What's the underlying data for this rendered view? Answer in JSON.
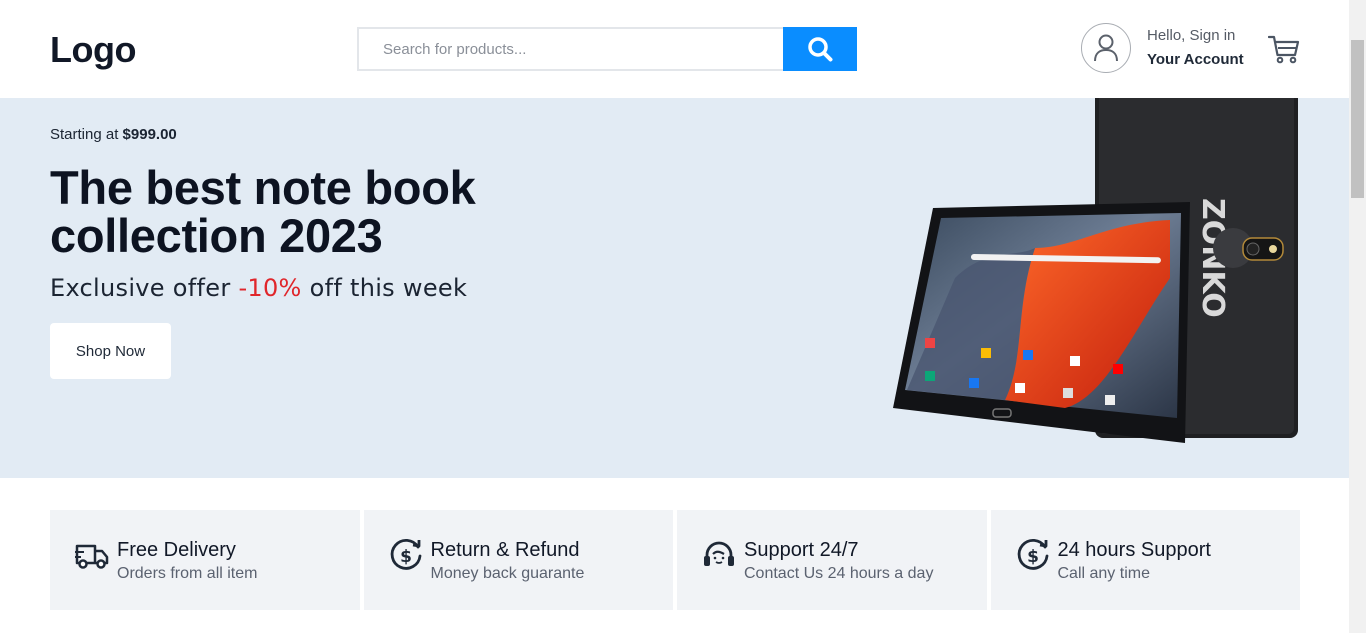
{
  "header": {
    "logo": "Logo",
    "search_placeholder": "Search for products...",
    "account_greeting": "Hello, Sign in",
    "account_label": "Your Account",
    "accent_color": "#0a8dff"
  },
  "hero": {
    "starting_prefix": "Starting at ",
    "starting_price": "$999.00",
    "title": "The best note book collection 2023",
    "offer_prefix": "Exclusive offer ",
    "offer_discount": "-10%",
    "offer_suffix": " off this week",
    "shop_button": "Shop Now",
    "background_color": "#e2ebf4",
    "discount_color": "#e0262b"
  },
  "features": [
    {
      "icon": "truck-icon",
      "title": "Free Delivery",
      "desc": "Orders from all item"
    },
    {
      "icon": "dollar-refund-icon",
      "title": "Return & Refund",
      "desc": "Money back guarante"
    },
    {
      "icon": "headset-icon",
      "title": "Support 24/7",
      "desc": "Contact Us 24 hours a day"
    },
    {
      "icon": "dollar-refund-icon",
      "title": "24 hours Support",
      "desc": "Call any time"
    }
  ]
}
